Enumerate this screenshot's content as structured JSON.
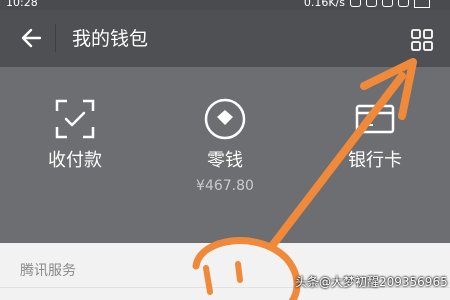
{
  "status_bar": {
    "time": "10:28",
    "network_speed": "0.16K/s"
  },
  "header": {
    "title": "我的钱包",
    "back_icon": "back-arrow-icon",
    "menu_icon": "grid-icon"
  },
  "wallet": {
    "items": [
      {
        "label": "收付款",
        "icon": "scan-pay-icon"
      },
      {
        "label": "零钱",
        "amount": "¥467.80",
        "icon": "change-wallet-icon"
      },
      {
        "label": "银行卡",
        "icon": "bank-card-icon"
      }
    ]
  },
  "services": {
    "title": "腾讯服务"
  },
  "annotation": {
    "color": "#f08a3a"
  },
  "watermark": {
    "text": "头条@大梦初醒209356965"
  }
}
